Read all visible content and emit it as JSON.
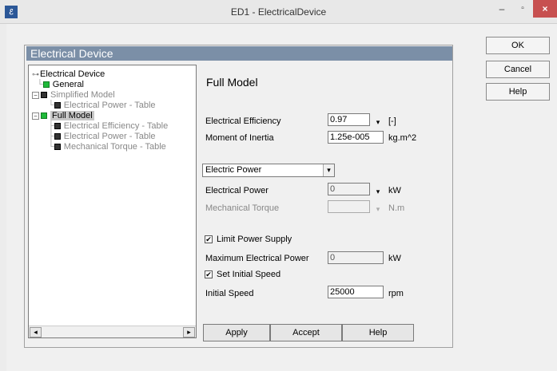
{
  "window": {
    "title": "ED1 - ElectricalDevice",
    "icon": "app-icon",
    "min_label": "–",
    "max_label": "▫",
    "close_label": "×"
  },
  "panel": {
    "header": "Electrical Device"
  },
  "tree": {
    "root": "Electrical Device",
    "items": [
      {
        "label": "General"
      },
      {
        "label": "Simplified Model"
      },
      {
        "label": "Electrical Power - Table"
      },
      {
        "label": "Full Model"
      },
      {
        "label": "Electrical Efficiency - Table"
      },
      {
        "label": "Electrical Power - Table"
      },
      {
        "label": "Mechanical Torque - Table"
      }
    ],
    "scroll_left": "◂",
    "scroll_right": "▸"
  },
  "form": {
    "title": "Full Model",
    "efficiency": {
      "label": "Electrical Efficiency",
      "value": "0.97",
      "unit": "[-]"
    },
    "inertia": {
      "label": "Moment of Inertia",
      "value": "1.25e-005",
      "unit": "kg.m^2"
    },
    "select": {
      "value": "Electric Power",
      "arrow": "▾"
    },
    "elec_power": {
      "label": "Electrical Power",
      "value": "0",
      "unit": "kW"
    },
    "mech_torque": {
      "label": "Mechanical Torque",
      "value": "",
      "unit": "N.m"
    },
    "limit_power": {
      "label": "Limit Power Supply",
      "checked": "✔"
    },
    "max_power": {
      "label": "Maximum Electrical Power",
      "value": "0",
      "unit": "kW"
    },
    "set_speed": {
      "label": "Set Initial Speed",
      "checked": "✔"
    },
    "initial_speed": {
      "label": "Initial Speed",
      "value": "25000",
      "unit": "rpm"
    },
    "dd_arrow": "▾"
  },
  "buttons": {
    "apply": "Apply",
    "accept": "Accept",
    "help": "Help"
  },
  "side_buttons": {
    "ok": "OK",
    "cancel": "Cancel",
    "help": "Help"
  },
  "colors": {
    "header": "#7b8fa7",
    "green_node": "#1fba3a",
    "close": "#c75050"
  }
}
